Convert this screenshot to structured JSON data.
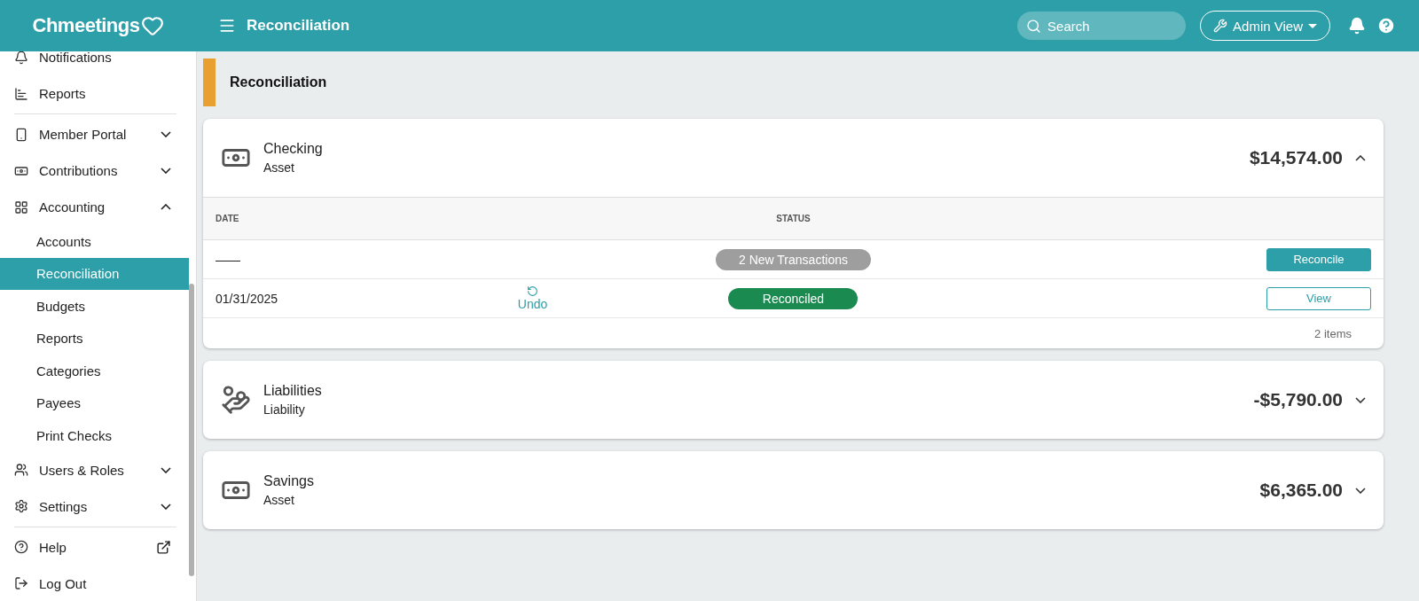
{
  "header": {
    "logo": "Chmeetings",
    "title": "Reconciliation",
    "search": {
      "placeholder": "Search"
    },
    "view_button": "Admin View"
  },
  "sidebar": {
    "items": [
      {
        "label": "Notifications",
        "kind": "item"
      },
      {
        "label": "Reports",
        "kind": "item",
        "divider_after": true
      },
      {
        "label": "Member Portal",
        "kind": "group",
        "expanded": false
      },
      {
        "label": "Contributions",
        "kind": "group",
        "expanded": false
      },
      {
        "label": "Accounting",
        "kind": "group",
        "expanded": true,
        "children": [
          {
            "label": "Accounts",
            "selected": false
          },
          {
            "label": "Reconciliation",
            "selected": true
          },
          {
            "label": "Budgets",
            "selected": false
          },
          {
            "label": "Reports",
            "selected": false
          },
          {
            "label": "Categories",
            "selected": false
          },
          {
            "label": "Payees",
            "selected": false
          },
          {
            "label": "Print Checks",
            "selected": false
          }
        ]
      },
      {
        "label": "Users & Roles",
        "kind": "group",
        "expanded": false
      },
      {
        "label": "Settings",
        "kind": "group",
        "expanded": false,
        "divider_after": true
      },
      {
        "label": "Help",
        "kind": "external"
      },
      {
        "label": "Log Out",
        "kind": "item"
      }
    ]
  },
  "page_title": "Reconciliation",
  "accounts": [
    {
      "name": "Checking",
      "type": "Asset",
      "amount": "$14,574.00",
      "expanded": true,
      "table": {
        "columns": [
          "DATE",
          "STATUS"
        ],
        "rows": [
          {
            "date": "——",
            "status": "2 New Transactions",
            "color": "#9e9e9e",
            "action": {
              "label": "Reconcile",
              "kind": "primary"
            }
          },
          {
            "date": "01/31/2025",
            "undo": "Undo",
            "status": "Reconciled",
            "color": "#1a8a50",
            "action": {
              "label": "View",
              "kind": "outline"
            }
          }
        ],
        "footer": "2 items"
      }
    },
    {
      "name": "Liabilities",
      "type": "Liability",
      "amount": "-$5,790.00",
      "expanded": false
    },
    {
      "name": "Savings",
      "type": "Asset",
      "amount": "$6,365.00",
      "expanded": false
    }
  ]
}
